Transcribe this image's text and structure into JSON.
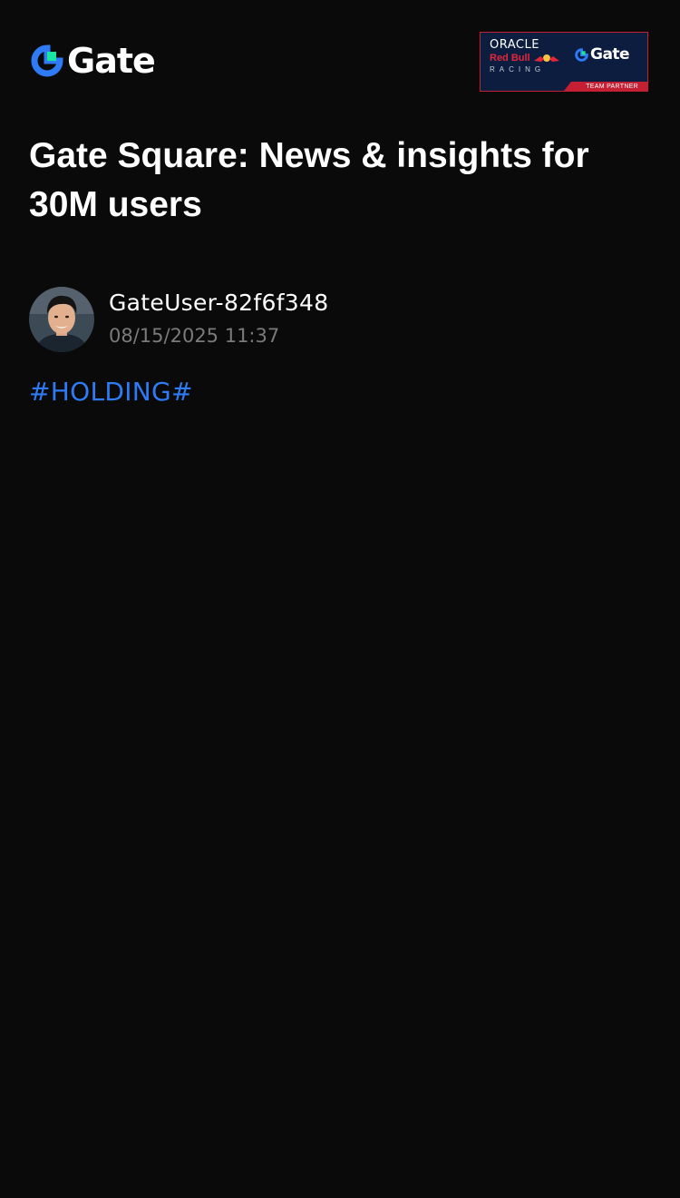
{
  "header": {
    "logo_text": "Gate",
    "partner": {
      "line1": "ORACLE",
      "line2": "Red Bull",
      "line3": "RACING",
      "brand": "Gate",
      "footer": "TEAM PARTNER"
    }
  },
  "title": "Gate Square: News & insights for 30M users",
  "post": {
    "author": "GateUser-82f6f348",
    "timestamp": "08/15/2025 11:37",
    "hashtag": "#HOLDING#"
  },
  "colors": {
    "background": "#0a0a0a",
    "brand_blue": "#2f7bf5",
    "brand_green": "#17e5a0",
    "hashtag": "#2f7bf5",
    "timestamp": "#7a7a7a",
    "partner_navy": "#0c1d3f",
    "partner_red": "#c51f34"
  },
  "icons": {
    "logo": "gate-logo-icon",
    "partner": "red-bull-icon",
    "avatar": "user-avatar"
  }
}
